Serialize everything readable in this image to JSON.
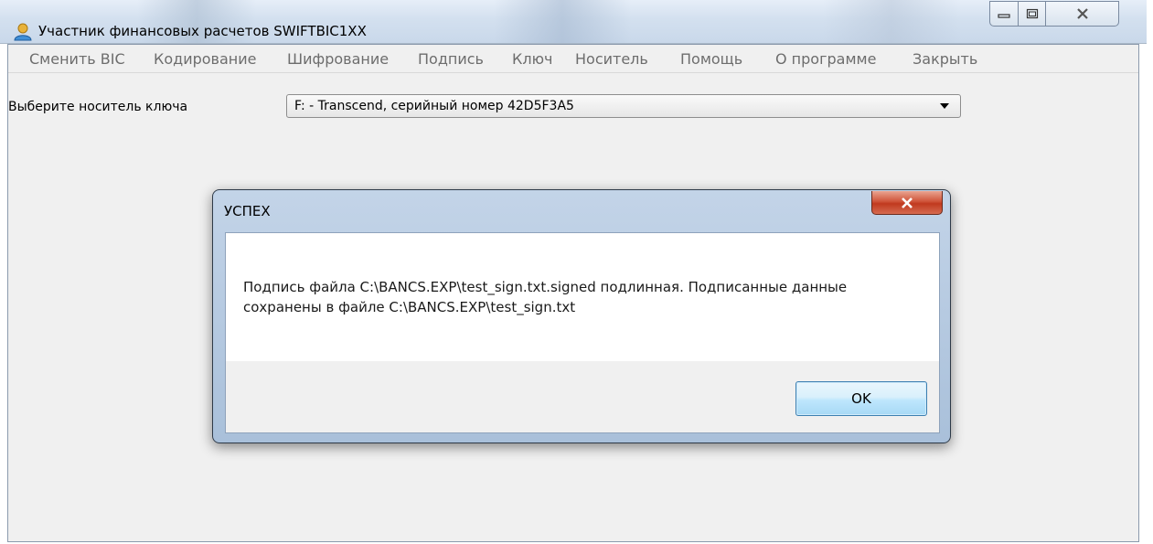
{
  "window": {
    "title": "Участник финансовых расчетов SWIFTBIC1XX",
    "icon": "user-icon"
  },
  "menu": {
    "items": [
      "Сменить BIC",
      "Кодирование",
      "Шифрование",
      "Подпись",
      "Ключ",
      "Носитель",
      "Помощь",
      "О программе",
      "Закрыть"
    ]
  },
  "key_media": {
    "label": "Выберите носитель ключа",
    "selected": "F: - Transcend, серийный номер 42D5F3A5"
  },
  "dialog": {
    "title": "УСПЕХ",
    "message": "Подпись файла C:\\BANCS.EXP\\test_sign.txt.signed подлинная. Подписанные данные сохранены в файле C:\\BANCS.EXP\\test_sign.txt",
    "ok_label": "OK"
  },
  "colors": {
    "dialog_frame": "#a9c0da",
    "close_button": "#c0391f",
    "ok_button_border": "#3c7fb1"
  }
}
